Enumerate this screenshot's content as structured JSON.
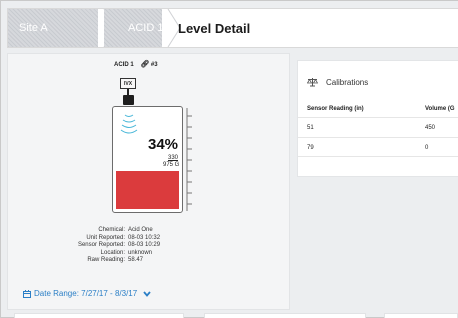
{
  "breadcrumb": {
    "items": [
      "Site A",
      "ACID 1"
    ],
    "current": "Level Detail"
  },
  "tank": {
    "title": "ACID 1",
    "suffix": "#3",
    "sensor_label": "IVX",
    "percent": "34%",
    "fill_fraction": 0.34,
    "current_volume": "330",
    "capacity": "975 G",
    "fill_color": "#db3b3d"
  },
  "info": [
    {
      "key": "Chemical:",
      "value": "Acid One"
    },
    {
      "key": "Unit Reported:",
      "value": "08-03 10:32"
    },
    {
      "key": "Sensor Reported:",
      "value": "08-03 10:29"
    },
    {
      "key": "Location:",
      "value": "unknown"
    },
    {
      "key": "Raw Reading:",
      "value": "58.47"
    }
  ],
  "date_range": {
    "label": "Date Range: 7/27/17 - 8/3/17",
    "accent": "#2b7fc6"
  },
  "calibrations": {
    "title": "Calibrations",
    "columns": [
      "Sensor Reading (in)",
      "Volume (G"
    ],
    "rows": [
      [
        "51",
        "450"
      ],
      [
        "79",
        "0"
      ]
    ]
  }
}
